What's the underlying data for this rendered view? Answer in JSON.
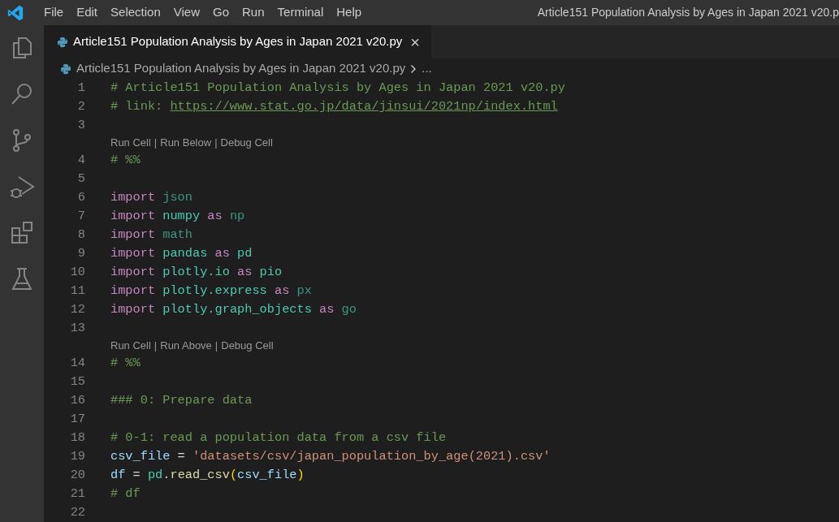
{
  "menu": [
    "File",
    "Edit",
    "Selection",
    "View",
    "Go",
    "Run",
    "Terminal",
    "Help"
  ],
  "window": {
    "title": "Article151 Population Analysis by Ages in Japan 2021 v20.p"
  },
  "tabs": [
    {
      "label": "Article151 Population Analysis by Ages in Japan 2021 v20.py",
      "selected": true,
      "close": "×"
    }
  ],
  "breadcrumb": {
    "file": "Article151 Population Analysis by Ages in Japan 2021 v20.py",
    "more": "..."
  },
  "lines": [
    {
      "kind": "code",
      "number": "1",
      "tokens": [
        {
          "kind": "comment",
          "text": "# Article151 Population Analysis by Ages in Japan 2021 v20.py"
        }
      ]
    },
    {
      "kind": "code",
      "number": "2",
      "tokens": [
        {
          "kind": "comment",
          "text": "# link: "
        },
        {
          "kind": "link",
          "text": "https://www.stat.go.jp/data/jinsui/2021np/index.html"
        }
      ]
    },
    {
      "kind": "code",
      "number": "3"
    },
    {
      "kind": "codelens",
      "actions": [
        "Run Cell",
        "Run Below",
        "Debug Cell"
      ],
      "separator": "|"
    },
    {
      "kind": "code",
      "number": "4",
      "tokens": [
        {
          "kind": "comment",
          "text": "# %%"
        }
      ]
    },
    {
      "kind": "code",
      "number": "5"
    },
    {
      "kind": "code",
      "number": "6",
      "tokens": [
        {
          "kind": "keyword",
          "text": "import "
        },
        {
          "kind": "unused",
          "text": "json"
        }
      ]
    },
    {
      "kind": "code",
      "number": "7",
      "tokens": [
        {
          "kind": "keyword",
          "text": "import "
        },
        {
          "kind": "module",
          "text": "numpy "
        },
        {
          "kind": "keyword",
          "text": "as "
        },
        {
          "kind": "unused",
          "text": "np"
        }
      ]
    },
    {
      "kind": "code",
      "number": "8",
      "tokens": [
        {
          "kind": "keyword",
          "text": "import "
        },
        {
          "kind": "unused",
          "text": "math"
        }
      ]
    },
    {
      "kind": "code",
      "number": "9",
      "tokens": [
        {
          "kind": "keyword",
          "text": "import "
        },
        {
          "kind": "module",
          "text": "pandas "
        },
        {
          "kind": "keyword",
          "text": "as "
        },
        {
          "kind": "module",
          "text": "pd"
        }
      ]
    },
    {
      "kind": "code",
      "number": "10",
      "tokens": [
        {
          "kind": "keyword",
          "text": "import "
        },
        {
          "kind": "module",
          "text": "plotly.io "
        },
        {
          "kind": "keyword",
          "text": "as "
        },
        {
          "kind": "module",
          "text": "pio"
        }
      ]
    },
    {
      "kind": "code",
      "number": "11",
      "tokens": [
        {
          "kind": "keyword",
          "text": "import "
        },
        {
          "kind": "module",
          "text": "plotly.express "
        },
        {
          "kind": "keyword",
          "text": "as "
        },
        {
          "kind": "unused",
          "text": "px"
        }
      ]
    },
    {
      "kind": "code",
      "number": "12",
      "tokens": [
        {
          "kind": "keyword",
          "text": "import "
        },
        {
          "kind": "module",
          "text": "plotly.graph_objects "
        },
        {
          "kind": "keyword",
          "text": "as "
        },
        {
          "kind": "unused",
          "text": "go"
        }
      ]
    },
    {
      "kind": "code",
      "number": "13"
    },
    {
      "kind": "codelens",
      "actions": [
        "Run Cell",
        "Run Above",
        "Debug Cell"
      ],
      "separator": "|"
    },
    {
      "kind": "code",
      "number": "14",
      "tokens": [
        {
          "kind": "comment",
          "text": "# %%"
        }
      ]
    },
    {
      "kind": "code",
      "number": "15"
    },
    {
      "kind": "code",
      "number": "16",
      "tokens": [
        {
          "kind": "comment",
          "text": "### 0: Prepare data"
        }
      ]
    },
    {
      "kind": "code",
      "number": "17"
    },
    {
      "kind": "code",
      "number": "18",
      "tokens": [
        {
          "kind": "comment",
          "text": "# 0-1: read a population data from a csv file"
        }
      ]
    },
    {
      "kind": "code",
      "number": "19",
      "tokens": [
        {
          "kind": "variable",
          "text": "csv_file"
        },
        {
          "kind": "plain",
          "text": " = "
        },
        {
          "kind": "string",
          "text": "'datasets/csv/japan_population_by_age(2021).csv'"
        }
      ]
    },
    {
      "kind": "code",
      "number": "20",
      "tokens": [
        {
          "kind": "variable",
          "text": "df"
        },
        {
          "kind": "plain",
          "text": " = "
        },
        {
          "kind": "module",
          "text": "pd"
        },
        {
          "kind": "plain",
          "text": "."
        },
        {
          "kind": "function",
          "text": "read_csv"
        },
        {
          "kind": "paren",
          "text": "("
        },
        {
          "kind": "variable",
          "text": "csv_file"
        },
        {
          "kind": "paren",
          "text": ")"
        }
      ]
    },
    {
      "kind": "code",
      "number": "21",
      "tokens": [
        {
          "kind": "comment",
          "text": "# df"
        }
      ]
    },
    {
      "kind": "code",
      "number": "22"
    }
  ]
}
